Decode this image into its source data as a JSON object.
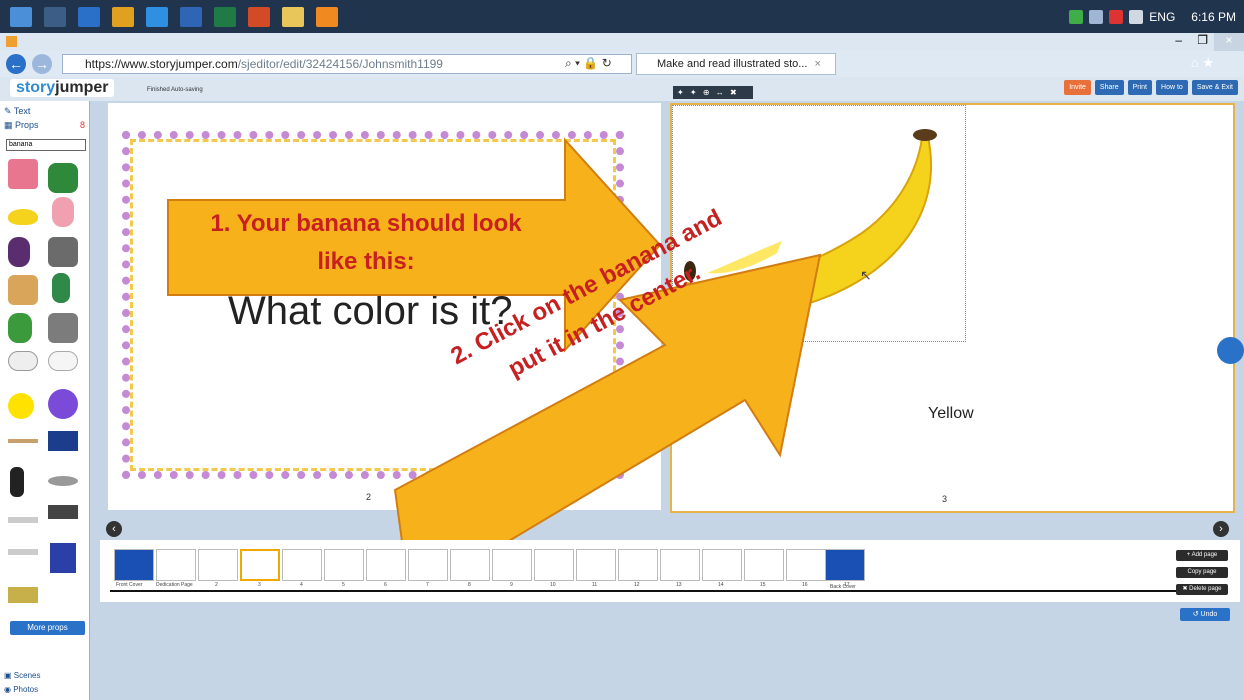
{
  "system": {
    "clock": "6:16 PM",
    "lang": "ENG"
  },
  "browser": {
    "url_domain": "https://www.storyjumper.com",
    "url_path": "/sjeditor/edit/32424156/Johnsmith1199",
    "tab_title": "Make and read illustrated sto...",
    "tab_close": "×"
  },
  "app": {
    "logo_pre": "story",
    "logo_post": "jumper",
    "saving": "Finished Auto-saving",
    "edit_toolbar": "✦ ✦ ⊕ ↔ ✖",
    "buttons": [
      "Invite",
      "Share",
      "Print",
      "How to",
      "Save & Exit"
    ]
  },
  "sidebar": {
    "text_tab": "Text",
    "props_tab": "Props",
    "props_count": "8",
    "search_value": "banana",
    "more_props": "More props",
    "scenes_tab": "Scenes",
    "photos_tab": "Photos"
  },
  "pages": {
    "left_text": "What color is it?",
    "left_num": "2",
    "right_label": "Yellow",
    "right_num": "3"
  },
  "annotations": {
    "arrow1_line1": "1. Your banana should look",
    "arrow1_line2": "like this:",
    "arrow2_line1": "2. Click on the banana and",
    "arrow2_line2": "put it in the center."
  },
  "thumbs": {
    "labels": [
      "Front Cover",
      "Dedication Page",
      "2",
      "3",
      "4",
      "5",
      "6",
      "7",
      "8",
      "9",
      "10",
      "11",
      "12",
      "13",
      "14",
      "15",
      "16",
      "17",
      "Back Cover"
    ],
    "add_page": "+ Add page",
    "copy_page": "Copy page",
    "delete_page": "✖ Delete page",
    "undo": "Undo"
  },
  "colors": {
    "accent": "#2a72c8",
    "arrow": "#f7b21b",
    "arrow_text": "#c62020",
    "banana": "#f5d21c"
  }
}
